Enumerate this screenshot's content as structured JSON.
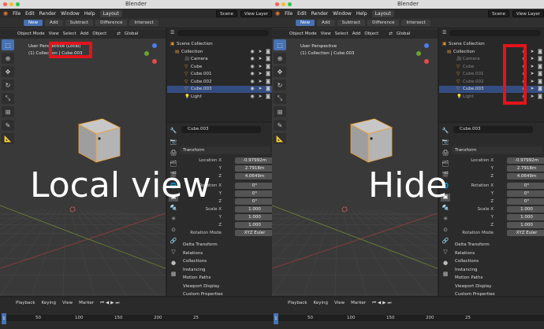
{
  "window_title": "Blender",
  "menu": [
    "File",
    "Edit",
    "Render",
    "Window",
    "Help"
  ],
  "workspace": "Layout",
  "scene": "Scene",
  "view_layer": "View Layer",
  "mode_buttons": [
    "New",
    "Add",
    "Subtract",
    "Difference",
    "Intersect"
  ],
  "viewport_header": [
    "Object Mode",
    "View",
    "Select",
    "Add",
    "Object"
  ],
  "orientation": "Global",
  "panes": [
    {
      "caption": "Local view",
      "perspective": "User Perspective (Local)",
      "collection_label": "(1) Collection | Cube.003"
    },
    {
      "caption": "Hide",
      "perspective": "User Perspective",
      "collection_label": "(1) Collection | Cube.003"
    }
  ],
  "outliner": {
    "root": "Scene Collection",
    "collection": "Collection",
    "items": [
      "Camera",
      "Cube",
      "Cube.001",
      "Cube.002",
      "Cube.003",
      "Light"
    ]
  },
  "properties": {
    "object_name": "Cube.003",
    "section_transform": "Transform",
    "location_label": "Location X",
    "rotation_label": "Rotation X",
    "scale_label": "Scale X",
    "y_label": "Y",
    "z_label": "Z",
    "location": [
      "-0.97992m",
      "2.7918m",
      "4.0649m"
    ],
    "rotation": [
      "0°",
      "0°",
      "0°"
    ],
    "scale": [
      "1.000",
      "1.000",
      "1.000"
    ],
    "rotation_mode_label": "Rotation Mode",
    "rotation_mode": "XYZ Euler",
    "sections": [
      "Delta Transform",
      "Relations",
      "Collections",
      "Instancing",
      "Motion Paths",
      "Viewport Display",
      "Custom Properties"
    ]
  },
  "timeline": {
    "menu": [
      "Playback",
      "Keying",
      "View",
      "Marker"
    ],
    "current_frame": "1",
    "ruler": [
      "50",
      "100",
      "150",
      "200",
      "25"
    ]
  },
  "colors": {
    "active": "#4772b3",
    "highlight_box": "#e2141b",
    "selection_outline": "#f0a030"
  }
}
